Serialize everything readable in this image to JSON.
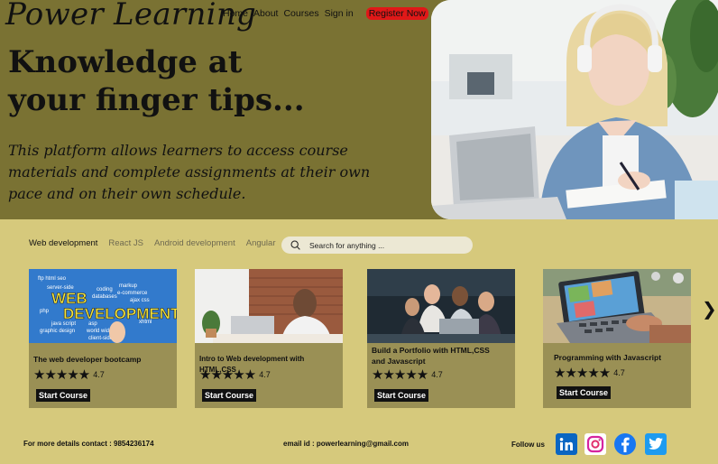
{
  "brand": {
    "logo": "Power Learning"
  },
  "nav": {
    "home": "Home",
    "about": "About",
    "courses": "Courses",
    "signin": "Sign in",
    "register": "Register Now"
  },
  "hero": {
    "headline": "Knowledge at your finger tips...",
    "description": "This platform allows learners to access course materials and complete assignments at their own pace and on their own schedule."
  },
  "tabs": [
    "Web development",
    "React JS",
    "Android development",
    "Angular"
  ],
  "search": {
    "placeholder": "Search for anything ..."
  },
  "courses": [
    {
      "title": "The web developer bootcamp",
      "rating": "4.7",
      "button": "Start Course",
      "thumb_words": [
        "WEB",
        "DEVELOPMENT"
      ]
    },
    {
      "title": "Intro to Web development with HTML,CSS",
      "rating": "4.7",
      "button": "Start Course"
    },
    {
      "title": "Build a Portfolio with HTML,CSS and Javascript",
      "rating": "4.7",
      "button": "Start Course"
    },
    {
      "title": "Programming with Javascript",
      "rating": "4.7",
      "button": "Start Course"
    }
  ],
  "footer": {
    "contact": "For more details contact : 9854236174",
    "email": "email id : powerlearning@gmail.com",
    "follow": "Follow us"
  },
  "colors": {
    "hero_bg": "#7a7233",
    "page_bg": "#d6c97c",
    "card_bg": "#9a9055",
    "register_bg": "#e01818"
  },
  "icons": [
    "search-icon",
    "chevron-right-icon",
    "linkedin-icon",
    "instagram-icon",
    "facebook-icon",
    "twitter-icon",
    "star-icon"
  ]
}
